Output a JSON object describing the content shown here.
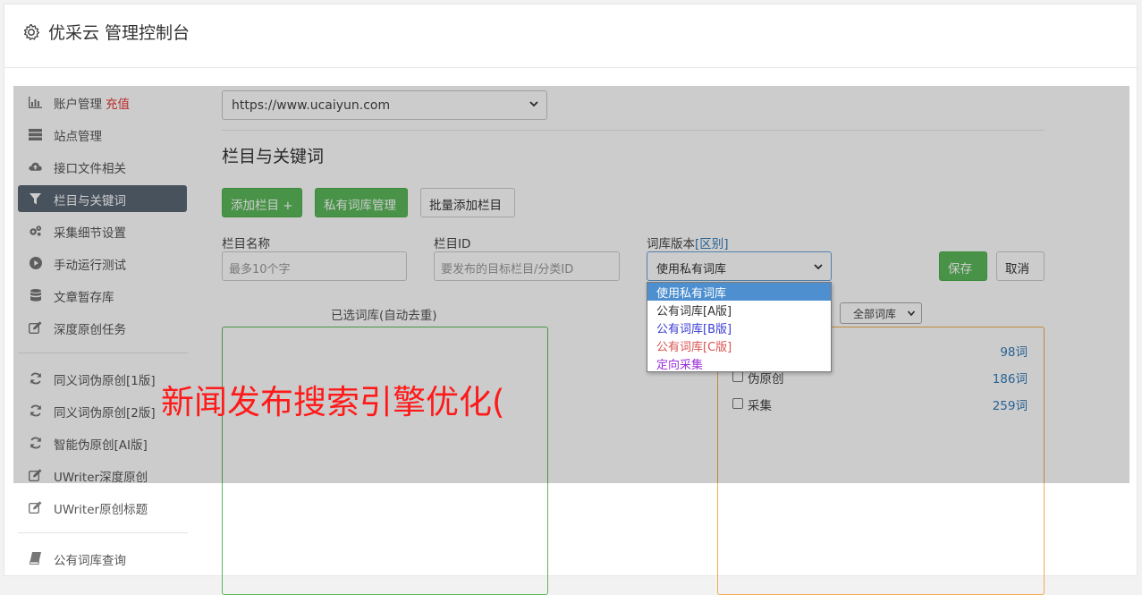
{
  "header": {
    "title": "优采云 管理控制台",
    "icon": "gear-icon"
  },
  "sidebar": {
    "items": [
      {
        "label": "账户管理",
        "badge": "充值",
        "icon": "bar-chart-icon"
      },
      {
        "label": "站点管理",
        "icon": "server-icon"
      },
      {
        "label": "接口文件相关",
        "icon": "cloud-upload-icon"
      },
      {
        "label": "栏目与关键词",
        "icon": "filter-icon",
        "active": true
      },
      {
        "label": "采集细节设置",
        "icon": "gears-icon"
      },
      {
        "label": "手动运行测试",
        "icon": "play-circle-icon"
      },
      {
        "label": "文章暂存库",
        "icon": "database-icon"
      },
      {
        "label": "深度原创任务",
        "icon": "edit-icon"
      },
      {
        "label": "同义词伪原创[1版]",
        "icon": "refresh-icon"
      },
      {
        "label": "同义词伪原创[2版]",
        "icon": "refresh-icon"
      },
      {
        "label": "智能伪原创[AI版]",
        "icon": "refresh-icon"
      },
      {
        "label": "UWriter深度原创",
        "icon": "edit-icon"
      },
      {
        "label": "UWriter原创标题",
        "icon": "edit-icon"
      },
      {
        "label": "公有词库查询",
        "icon": "book-icon"
      }
    ]
  },
  "main": {
    "site_select": "https://www.ucaiyun.com",
    "section_title": "栏目与关键词",
    "buttons": {
      "add_column": "添加栏目 +",
      "private_lib": "私有词库管理",
      "batch_add": "批量添加栏目"
    },
    "form": {
      "column_name_label": "栏目名称",
      "column_name_placeholder": "最多10个字",
      "column_id_label": "栏目ID",
      "column_id_placeholder": "要发布的目标栏目/分类ID",
      "lib_version_label": "词库版本",
      "lib_version_link": "[区别]",
      "lib_version_value": "使用私有词库",
      "save": "保存",
      "cancel": "取消"
    },
    "lib_version_options": [
      {
        "label": "使用私有词库",
        "color": "#ffffff",
        "selected": true
      },
      {
        "label": "公有词库[A版]",
        "color": "#333333"
      },
      {
        "label": "公有词库[B版]",
        "color": "#3a3ad6"
      },
      {
        "label": "公有词库[C版]",
        "color": "#d9534f"
      },
      {
        "label": "定向采集",
        "color": "#9b30d9"
      }
    ],
    "selected_libs_title": "已选词库(自动去重)",
    "lib_filter": "全部词库",
    "libraries": [
      {
        "name": "",
        "count": "98词"
      },
      {
        "name": "伪原创",
        "count": "186词"
      },
      {
        "name": "采集",
        "count": "259词"
      }
    ]
  },
  "watermark": "新闻发布搜索引擎优化("
}
